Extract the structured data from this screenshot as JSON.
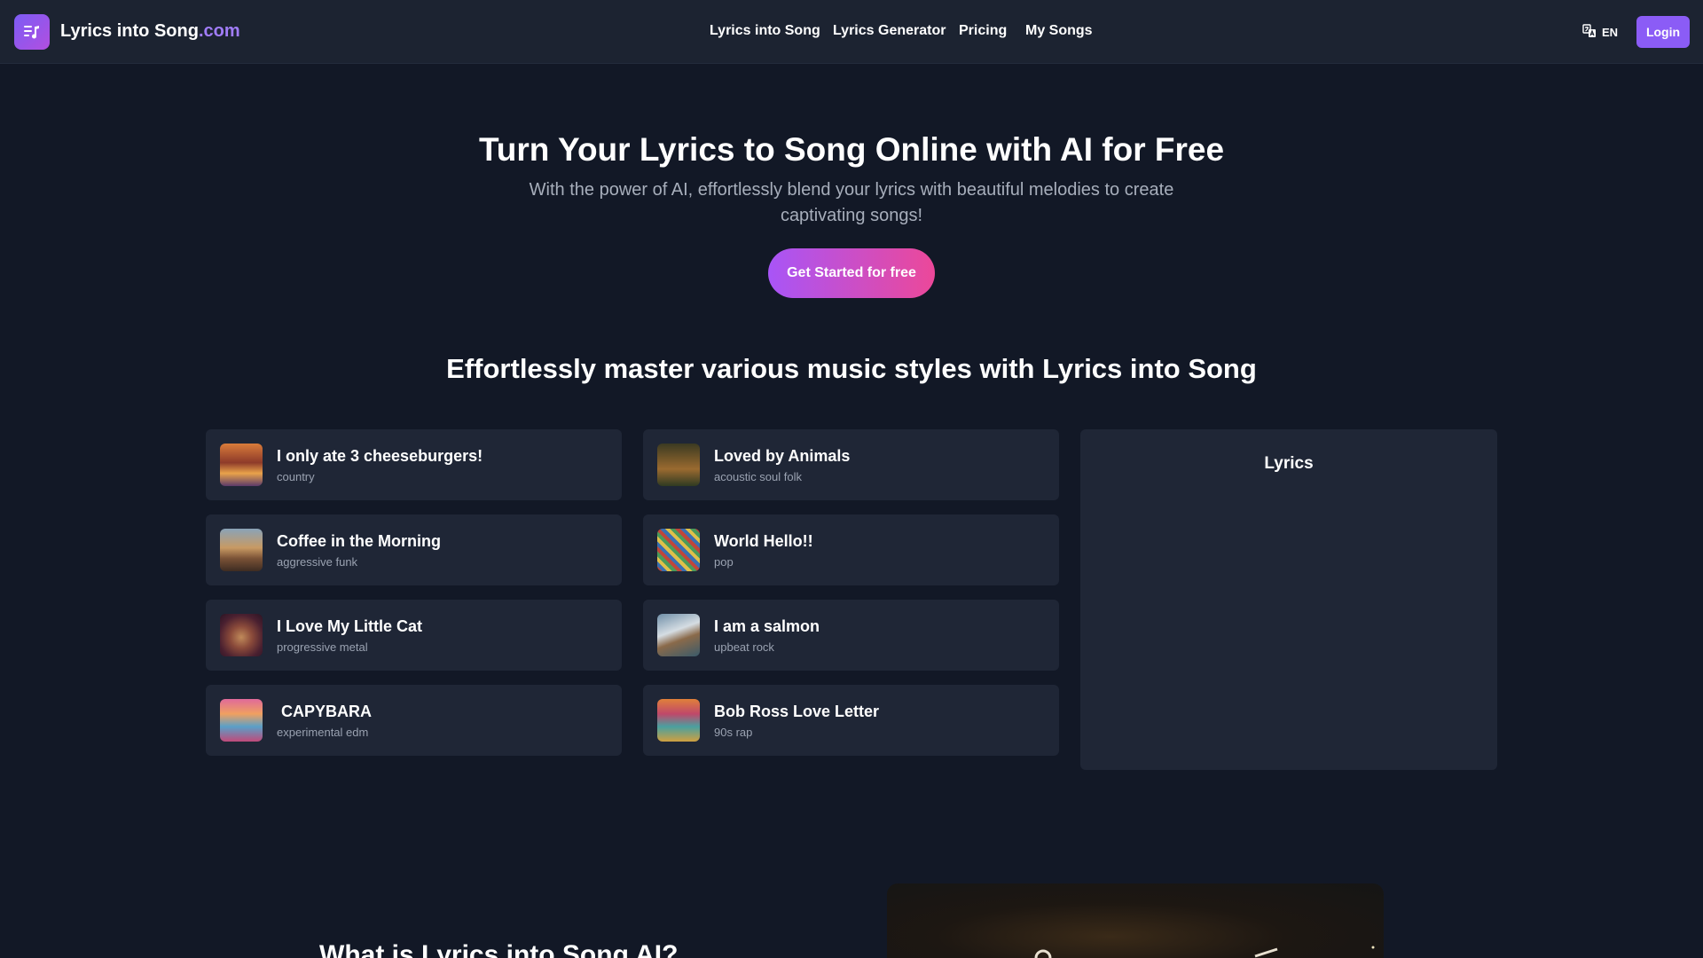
{
  "header": {
    "logo_name": "Lyrics into Song",
    "logo_suffix": ".com",
    "nav": [
      "Lyrics into Song",
      "Lyrics Generator",
      "Pricing",
      "My Songs"
    ],
    "language": "EN",
    "login_label": "Login"
  },
  "hero": {
    "title": "Turn Your Lyrics to Song Online with AI for Free",
    "subtitle": "With the power of AI, effortlessly blend your lyrics with beautiful melodies to create captivating songs!",
    "cta_label": "Get Started for free"
  },
  "styles_section": {
    "title": "Effortlessly master various music styles with Lyrics into Song",
    "songs": [
      {
        "title": "I only ate 3 cheeseburgers!",
        "style": "country"
      },
      {
        "title": "Loved by Animals",
        "style": "acoustic soul folk"
      },
      {
        "title": "Coffee in the Morning",
        "style": "aggressive funk"
      },
      {
        "title": "World Hello!!",
        "style": "pop"
      },
      {
        "title": "I Love My Little Cat",
        "style": "progressive metal"
      },
      {
        "title": "I am a salmon",
        "style": "upbeat rock"
      },
      {
        "title": " CAPYBARA",
        "style": "experimental edm"
      },
      {
        "title": "Bob Ross Love Letter",
        "style": "90s rap"
      }
    ],
    "lyrics_title": "Lyrics"
  },
  "about": {
    "title": "What is Lyrics into Song AI?"
  },
  "colors": {
    "background": "#121826",
    "header": "#1c2331",
    "card": "#1f2636",
    "accent": "#8b5cf6",
    "cta_start": "#a855f7",
    "cta_end": "#ec4899"
  }
}
